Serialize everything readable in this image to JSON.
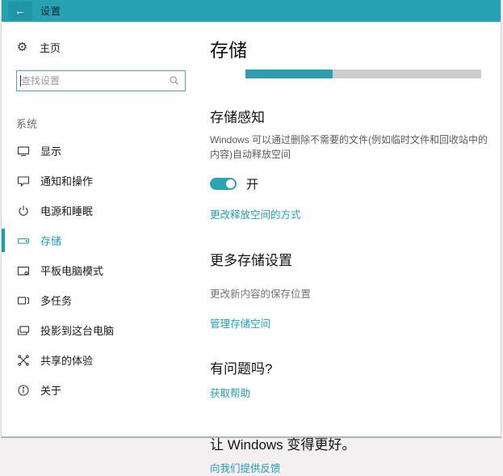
{
  "titlebar": {
    "back_glyph": "←",
    "title": "设置"
  },
  "sidebar": {
    "home_label": "主页",
    "search_placeholder": "查找设置",
    "section_label": "系统",
    "items": [
      {
        "label": "显示",
        "icon": "display-icon"
      },
      {
        "label": "通知和操作",
        "icon": "notifications-icon"
      },
      {
        "label": "电源和睡眠",
        "icon": "power-icon"
      },
      {
        "label": "存储",
        "icon": "storage-icon",
        "selected": true
      },
      {
        "label": "平板电脑模式",
        "icon": "tablet-icon"
      },
      {
        "label": "多任务",
        "icon": "multitasking-icon"
      },
      {
        "label": "投影到这台电脑",
        "icon": "projecting-icon"
      },
      {
        "label": "共享的体验",
        "icon": "shared-experiences-icon"
      },
      {
        "label": "关于",
        "icon": "about-icon"
      }
    ]
  },
  "content": {
    "page_title": "存储",
    "usage_bar": {
      "percent_used": 37,
      "fill_color": "#2e9dad",
      "track_color": "#cdcdcd"
    },
    "storage_sense": {
      "heading": "存储感知",
      "description_line1": "Windows 可以通过删除不需要的文件(例如临时文件和回收站中的",
      "description_line2": "内容)自动释放空间",
      "toggle_on": true,
      "toggle_label": "开",
      "change_link": "更改释放空间的方式"
    },
    "more_settings": {
      "heading": "更多存储设置",
      "subtext": "更改新内容的保存位置",
      "manage_link": "管理存储空间"
    },
    "help": {
      "heading": "有问题吗?",
      "link": "获取帮助"
    },
    "feedback": {
      "heading": "让 Windows 变得更好。",
      "link": "向我们提供反馈"
    }
  },
  "colors": {
    "accent": "#1d9fae",
    "titlebar": "#27a2b2",
    "link": "#1f9fb2"
  }
}
